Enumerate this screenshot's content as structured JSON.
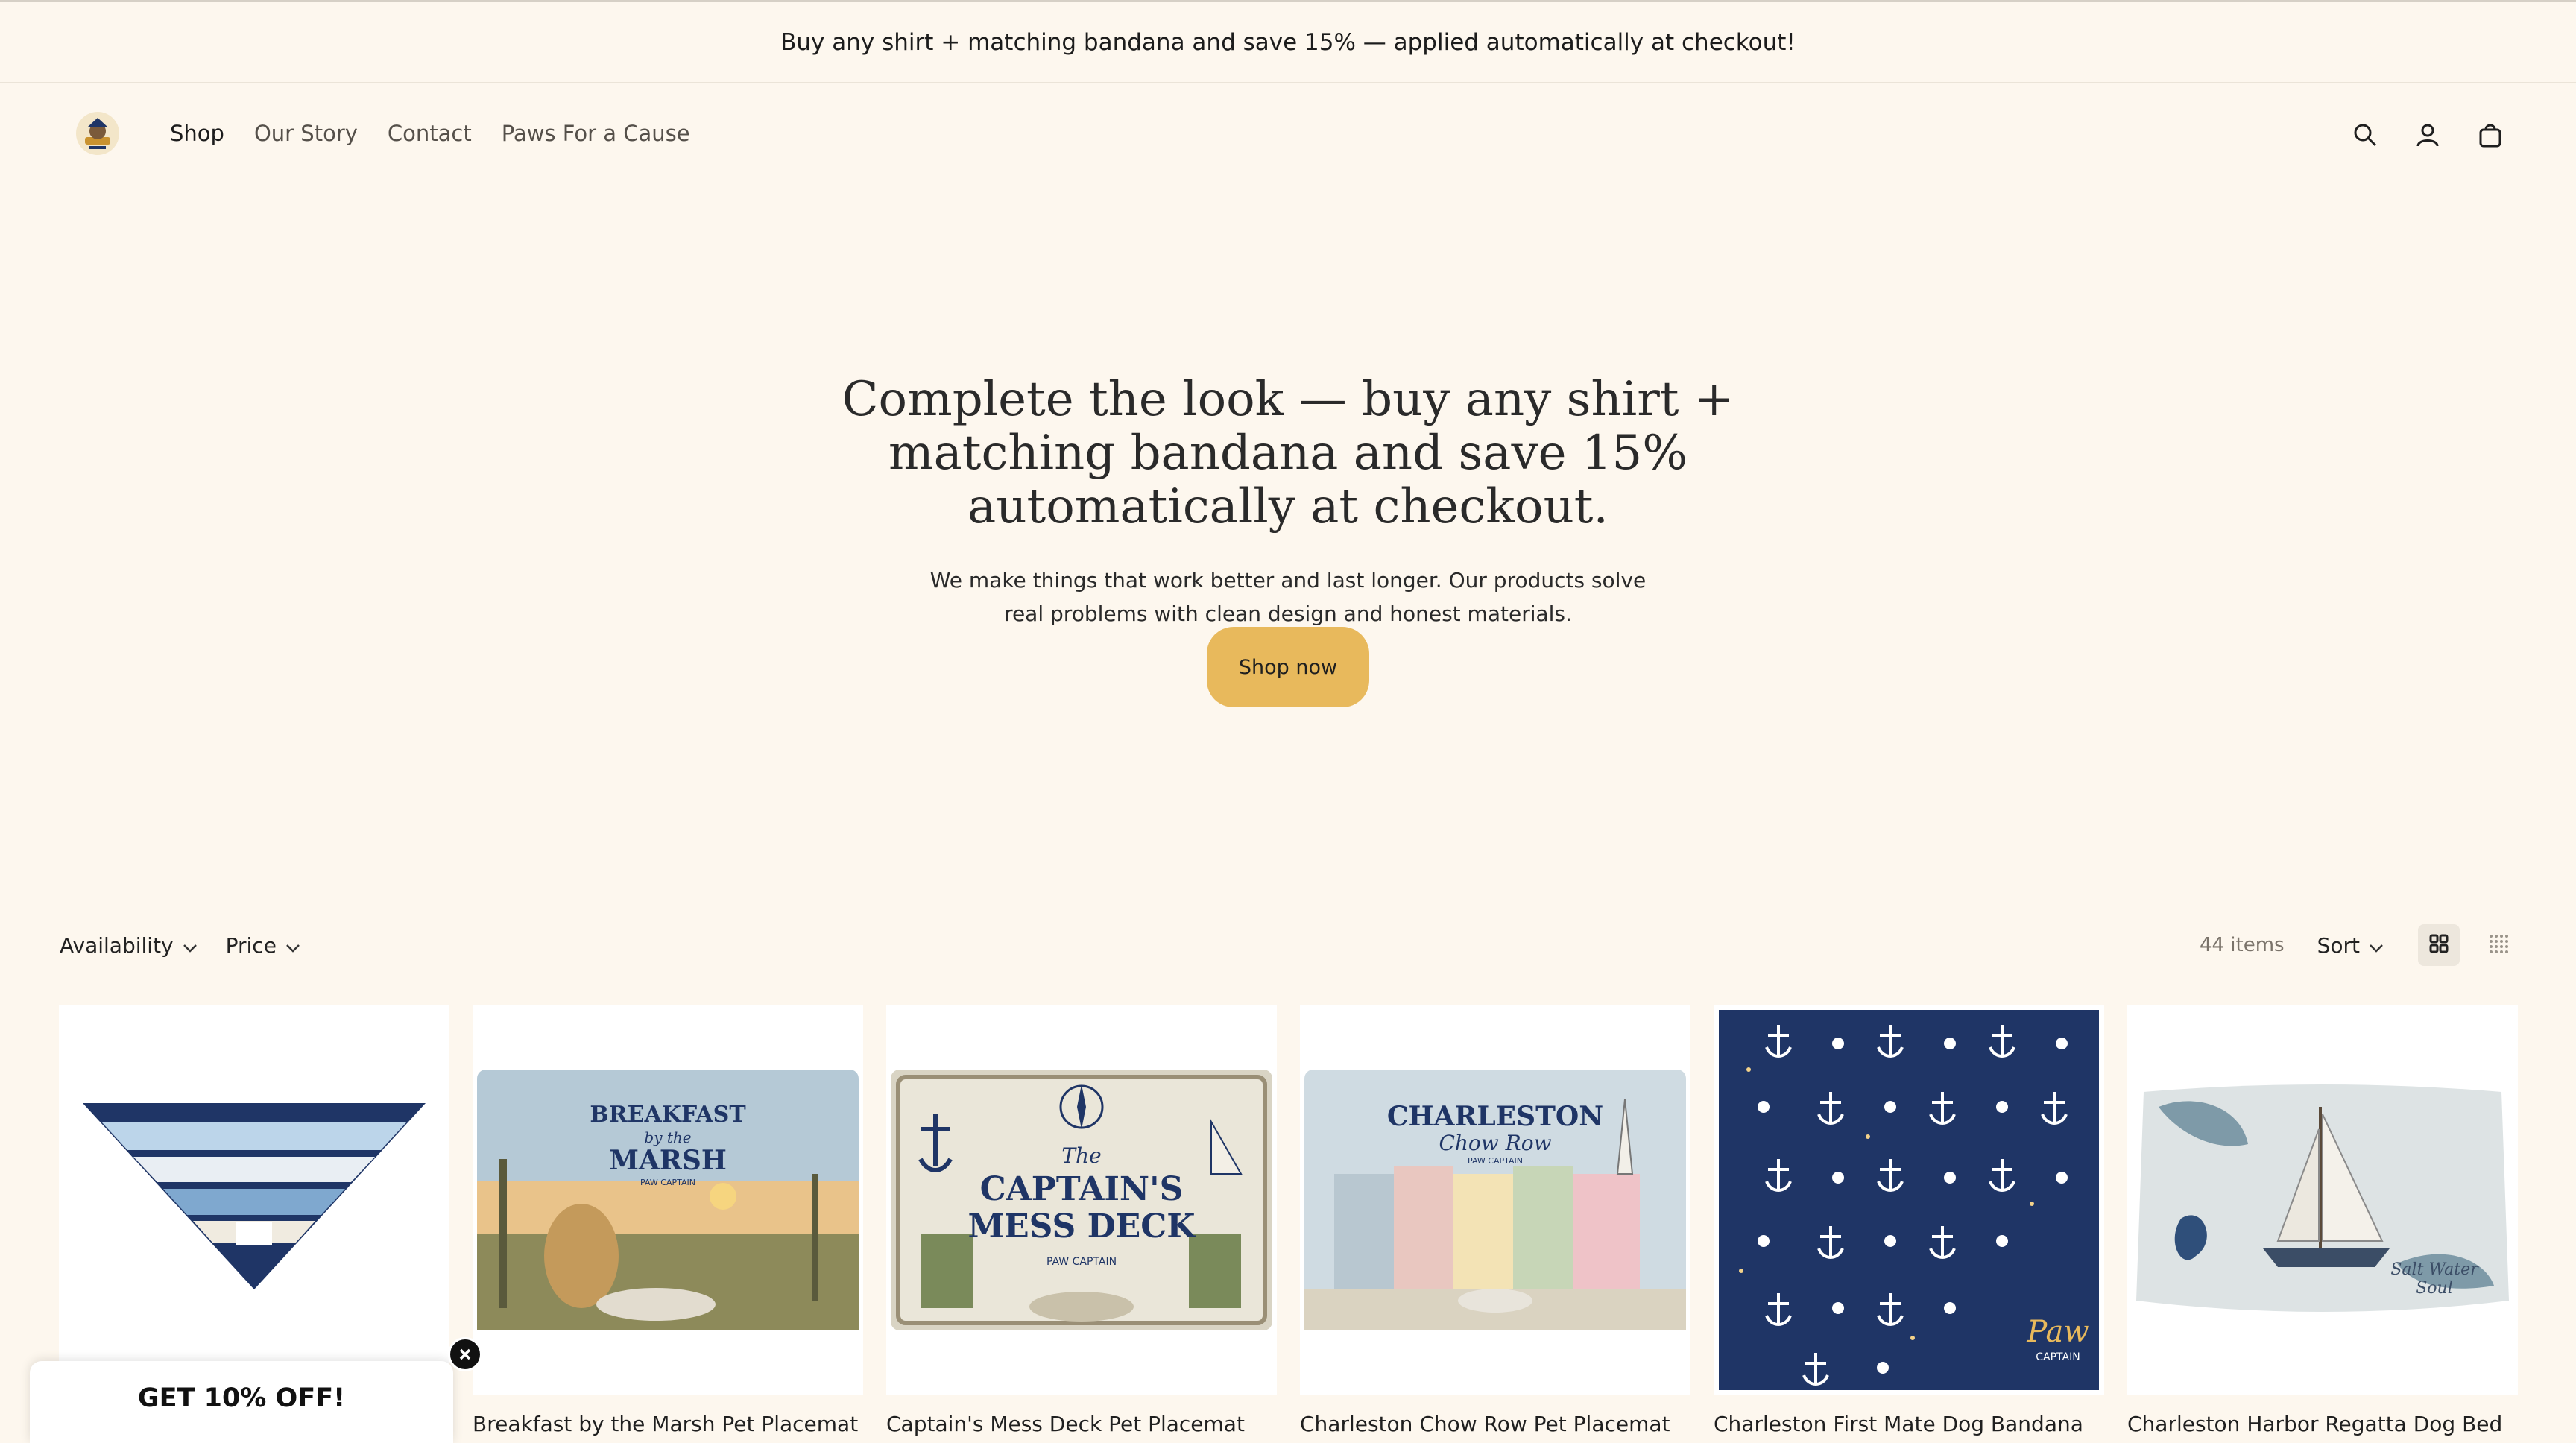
{
  "announcement": "Buy any shirt + matching bandana and save 15% — applied automatically at checkout!",
  "nav": [
    {
      "label": "Shop"
    },
    {
      "label": "Our Story"
    },
    {
      "label": "Contact"
    },
    {
      "label": "Paws For a Cause"
    }
  ],
  "header_icons": [
    "search-icon",
    "account-icon",
    "cart-icon"
  ],
  "hero": {
    "title": "Complete the look — buy any shirt + matching bandana and save 15% automatically at checkout.",
    "body": "We make things that work better and last longer. Our products solve real problems with clean design and honest materials.",
    "cta": "Shop now"
  },
  "filters": {
    "availability": "Availability",
    "price": "Price",
    "count": "44 items",
    "sort": "Sort"
  },
  "products": [
    {
      "title": ""
    },
    {
      "title": "Breakfast by the Marsh Pet Placemat",
      "image_text": [
        "BREAKFAST",
        "by the",
        "MARSH",
        "PAW CAPTAIN"
      ]
    },
    {
      "title": "Captain's Mess Deck Pet Placemat",
      "image_text": [
        "The",
        "CAPTAIN'S",
        "MESS DECK",
        "PAW CAPTAIN"
      ]
    },
    {
      "title": "Charleston Chow Row Pet Placemat",
      "image_text": [
        "CHARLESTON",
        "Chow Row",
        "PAW CAPTAIN"
      ]
    },
    {
      "title": "Charleston First Mate Dog Bandana",
      "image_text": [
        "Paw",
        "CAPTAIN"
      ]
    },
    {
      "title": "Charleston Harbor Regatta Dog Bed",
      "image_text": [
        "Salt Water",
        "Soul"
      ]
    }
  ],
  "popup": {
    "title": "GET 10% OFF!"
  },
  "colors": {
    "background": "#fdf7ee",
    "button": "#e8b95c",
    "navy": "#1f3566"
  }
}
